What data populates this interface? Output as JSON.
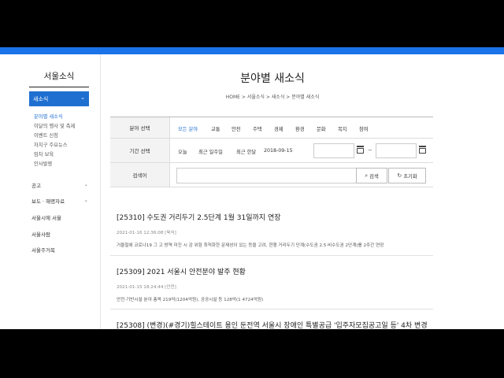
{
  "sidebar": {
    "title": "서울소식",
    "active": "새소식",
    "subs": [
      "분야별 새소식",
      "이달의 행사 및 축제",
      "이벤트 신청",
      "자치구 주요뉴스",
      "임차 보육",
      "인사발령"
    ],
    "menus": [
      "공고",
      "보도 · 해명자료",
      "서울시에 서울",
      "서울사람",
      "서울주거복"
    ]
  },
  "header": {
    "title": "분야별 새소식",
    "breadcrumb": [
      "HOME",
      "서울소식",
      "새소식",
      "분야별 새소식"
    ]
  },
  "filter": {
    "category_label": "분야 선택",
    "categories": [
      "모든 분야",
      "교통",
      "안전",
      "주택",
      "경제",
      "환경",
      "문화",
      "복지",
      "참여"
    ],
    "period_label": "기간 선택",
    "periods": [
      "오늘",
      "최근 일주일",
      "최근 한달",
      "2018-09-15"
    ],
    "keyword_label": "검색어",
    "search_button": "검색",
    "reset_button": "초기화"
  },
  "news": [
    {
      "title": "[25310] 수도권 거리두기 2.5단계 1월 31일까지 연장",
      "date": "2021-01-16 12:36:08 [육식]",
      "summary": "거울철에 코로나19 그 고 방역 미진 시 감 위험 최적화한 문제성이 있는 등을 고려, 현행 거리두기 단계(수도권 2.5·비수도권 2단계)를 2주간 연장"
    },
    {
      "title": "[25309] 2021 서울시 안전분야 발주 현황",
      "date": "2021-01-15 18:24:44 [안전]",
      "summary": "안전·기반시설 분야 총액 219억(1204억원), 공공시설 등 128억(1 4724억원)"
    },
    {
      "title": "[25308] (변경)(#경기)힐스테이트 용인 둔전역 서울시 장애인 특별공급 '입주자모집공고일 등' 4차 변경",
      "date": "",
      "summary": ""
    }
  ]
}
